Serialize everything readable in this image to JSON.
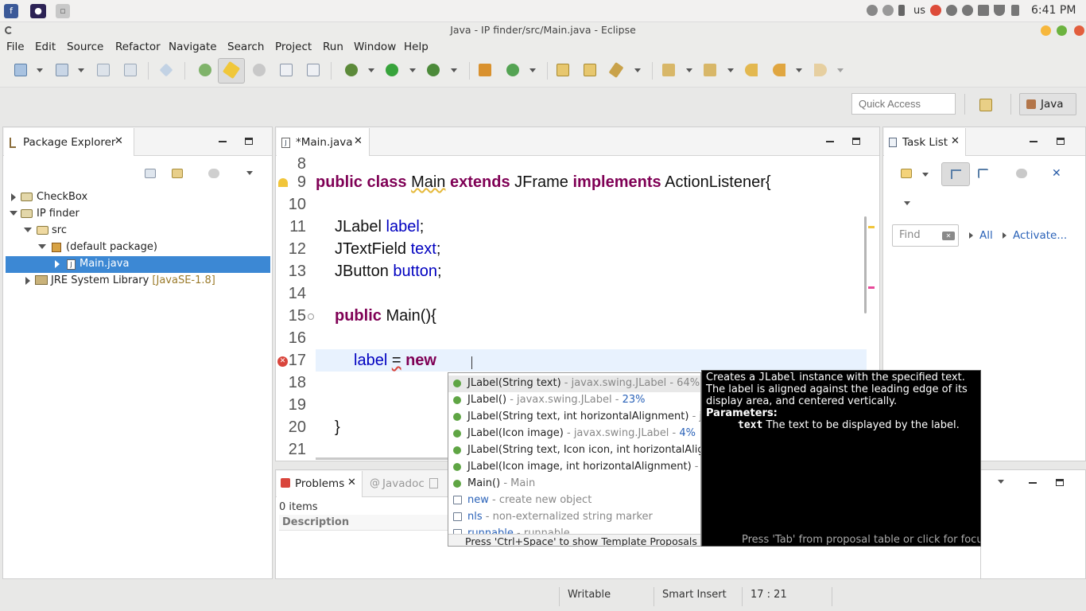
{
  "system_bar": {
    "lang": "us",
    "clock": "6:41 PM"
  },
  "window": {
    "title": "Java - IP finder/src/Main.java - Eclipse"
  },
  "menu": [
    "File",
    "Edit",
    "Source",
    "Refactor",
    "Navigate",
    "Search",
    "Project",
    "Run",
    "Window",
    "Help"
  ],
  "quick_access": {
    "placeholder": "Quick Access"
  },
  "perspective": {
    "label": "Java"
  },
  "package_explorer": {
    "tab_label": "Package Explorer",
    "items": [
      {
        "label": "CheckBox"
      },
      {
        "label": "IP finder"
      },
      {
        "label": "src"
      },
      {
        "label": "(default package)"
      },
      {
        "label": "Main.java"
      },
      {
        "label": "JRE System Library",
        "suffix": "[JavaSE-1.8]"
      }
    ]
  },
  "editor": {
    "tab_label": "*Main.java",
    "line_numbers": [
      "8",
      "9",
      "10",
      "11",
      "12",
      "13",
      "14",
      "15",
      "16",
      "17",
      "18",
      "19",
      "20",
      "21"
    ],
    "line9": {
      "kw1": "public class",
      "cls": "Main",
      "kw2": "extends",
      "t1": "JFrame",
      "kw3": "implements",
      "t2": "ActionListener{"
    },
    "line11": {
      "type": "JLabel",
      "field": "label",
      "end": ";"
    },
    "line12": {
      "type": "JTextField",
      "field": "text",
      "end": ";"
    },
    "line13": {
      "type": "JButton",
      "field": "button",
      "end": ";"
    },
    "line15": {
      "kw": "public",
      "rest": "Main(){"
    },
    "line17": {
      "field": "label",
      "op": "=",
      "kw": "new"
    },
    "line20": {
      "text": "}"
    }
  },
  "content_assist": {
    "proposals": [
      {
        "main": "JLabel(String text)",
        "extra": " - javax.swing.JLabel - ",
        "pct": "64%"
      },
      {
        "main": "JLabel()",
        "extra": " - javax.swing.JLabel - ",
        "pct": "23%"
      },
      {
        "main": "JLabel(String text, int horizontalAlignment)",
        "extra": " - ja",
        "pct": ""
      },
      {
        "main": "JLabel(Icon image)",
        "extra": " - javax.swing.JLabel - ",
        "pct": "4%"
      },
      {
        "main": "JLabel(String text, Icon icon, int horizontalAlign",
        "extra": "",
        "pct": ""
      },
      {
        "main": "JLabel(Icon image, int horizontalAlignment)",
        "extra": " - ja",
        "pct": ""
      },
      {
        "main": "Main()",
        "extra": " - Main",
        "pct": ""
      },
      {
        "main": "new",
        "extra": " - create new object",
        "pct": ""
      },
      {
        "main": "nls",
        "extra": " - non-externalized string marker",
        "pct": ""
      },
      {
        "main": "runnable",
        "extra": " - runnable",
        "pct": ""
      }
    ],
    "footer": "Press 'Ctrl+Space' to show Template Proposals"
  },
  "javadoc_popup": {
    "line1_a": "Creates a ",
    "line1_code": "JLabel",
    "line1_b": " instance with the specified text.",
    "line2": "The label is aligned against the leading edge of its",
    "line3": "display area, and centered vertically.",
    "params_heading": "Parameters:",
    "param_name": "text",
    "param_desc": " The text to be displayed by the label.",
    "footer": "Press 'Tab' from proposal table or click for focus"
  },
  "task_list": {
    "tab_label": "Task List",
    "find_placeholder": "Find",
    "all_label": "All",
    "activate_label": "Activate..."
  },
  "problems": {
    "tab_label": "Problems",
    "javadoc_tab": "Javadoc",
    "items_count": "0 items",
    "column_description": "Description"
  },
  "status": {
    "writable": "Writable",
    "insert_mode": "Smart Insert",
    "position": "17 : 21"
  },
  "colors": {
    "selection": "#3c88d4",
    "current_line": "#e8f2fe",
    "keyword": "#7f0055",
    "field": "#0000c0"
  }
}
